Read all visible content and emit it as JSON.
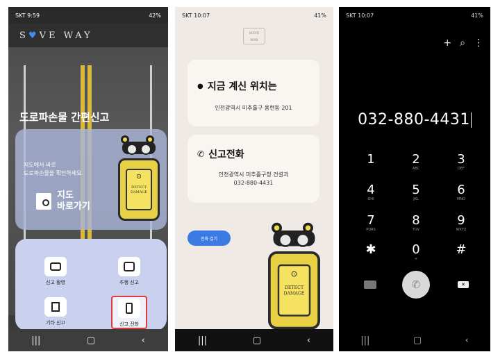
{
  "screen1": {
    "status": {
      "time": "SKT 9:59",
      "battery": "42%"
    },
    "brand": {
      "before": "S",
      "after": "VE WAY"
    },
    "headline": "도로파손물 간편신고",
    "map_card": {
      "description": "지도에서 바로\n도로파손물을 확인하세요",
      "button_label": "지도\n바로가기"
    },
    "robot_text": "DETECT\nDAMAGE",
    "tiles": [
      {
        "label": "신고 촬영"
      },
      {
        "label": "추행 신고"
      },
      {
        "label": "기타 신고"
      },
      {
        "label": "신고 전화"
      }
    ]
  },
  "screen2": {
    "status": {
      "time": "SKT 10:07",
      "battery": "41%"
    },
    "logo": "SOVE\nWAY",
    "location": {
      "title": "지금 계신 위치는",
      "address": "인천광역시 미추홀구 용현동 201"
    },
    "report": {
      "title": "신고전화",
      "office": "인천광역시 미추홀구청 건설과",
      "phone": "032-880-4431"
    },
    "call_button": "전화 걸기",
    "robot_text": "DETECT\nDAMAGE"
  },
  "screen3": {
    "status": {
      "time": "SKT 10:07",
      "battery": "41%"
    },
    "number": "032-880-4431",
    "keys": [
      {
        "d": "1",
        "l": ""
      },
      {
        "d": "2",
        "l": "ABC"
      },
      {
        "d": "3",
        "l": "DEF"
      },
      {
        "d": "4",
        "l": "GHI"
      },
      {
        "d": "5",
        "l": "JKL"
      },
      {
        "d": "6",
        "l": "MNO"
      },
      {
        "d": "7",
        "l": "PQRS"
      },
      {
        "d": "8",
        "l": "TUV"
      },
      {
        "d": "9",
        "l": "WXYZ"
      },
      {
        "d": "✱",
        "l": ""
      },
      {
        "d": "0",
        "l": "+"
      },
      {
        "d": "#",
        "l": ""
      }
    ]
  },
  "icons": [
    "location-pin-icon",
    "phone-icon",
    "camera-icon",
    "bus-icon",
    "document-icon",
    "mobile-icon",
    "video-call-icon",
    "backspace-icon",
    "plus-icon",
    "search-icon",
    "more-icon"
  ],
  "colors": {
    "accent_blue": "#3d7be4",
    "robot_yellow": "#e8d045",
    "highlight_red": "#e33b3b"
  }
}
